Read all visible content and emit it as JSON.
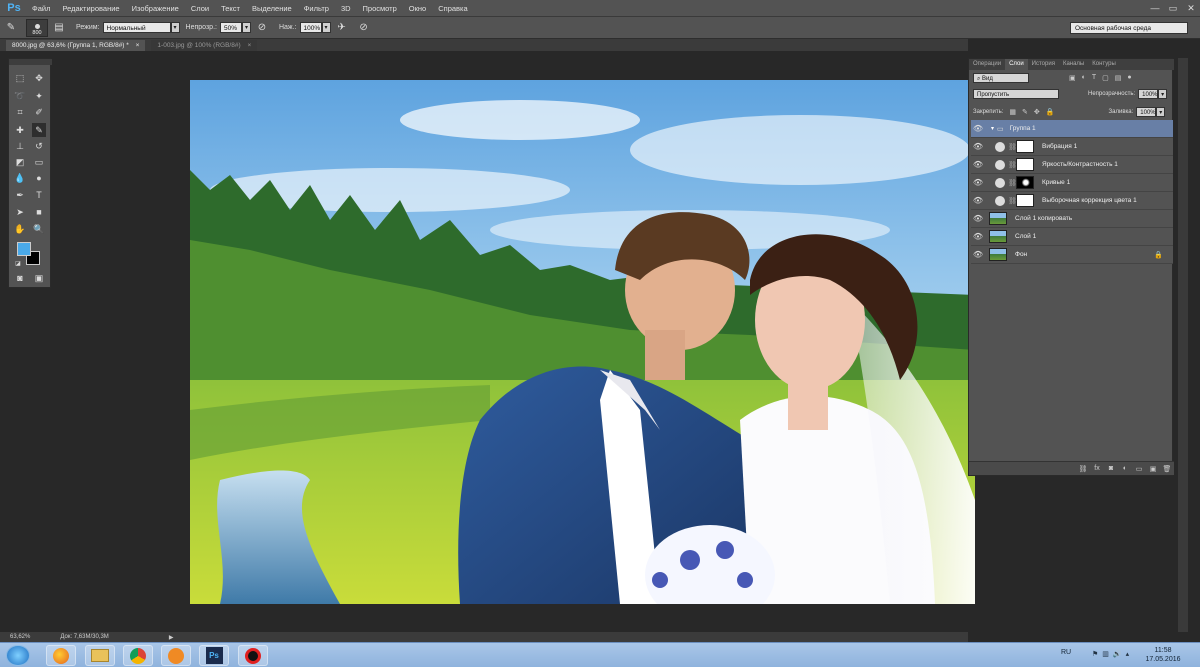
{
  "menu": {
    "logo": "Ps",
    "items": [
      "Файл",
      "Редактирование",
      "Изображение",
      "Слои",
      "Текст",
      "Выделение",
      "Фильтр",
      "3D",
      "Просмотр",
      "Окно",
      "Справка"
    ]
  },
  "window_controls": [
    "—",
    "▭",
    "✕"
  ],
  "options": {
    "brush_size": "800",
    "mode_label": "Режим:",
    "mode_value": "Нормальный",
    "opacity_label": "Непрозр.:",
    "opacity_value": "50%",
    "flow_label": "Наж.:",
    "flow_value": "100%",
    "workspace": "Основная рабочая среда"
  },
  "tabs": [
    {
      "label": "8000.jpg @ 63,6% (Группа 1, RGB/8#) *",
      "close": "×"
    },
    {
      "label": "1-003.jpg @ 100% (RGB/8#)",
      "close": "×"
    }
  ],
  "colors": {
    "foreground": "#4aa9e8",
    "background": "#000000",
    "selected_layer": "#687fa6",
    "ui_panel": "#535353"
  },
  "layers_panel": {
    "tabs": [
      "Операции",
      "Слои",
      "История",
      "Каналы",
      "Контуры"
    ],
    "active_tab": "Слои",
    "filter_kind": "Вид",
    "blend_mode": "Пропустить",
    "opacity_label": "Непрозрачность:",
    "opacity_value": "100%",
    "lock_label": "Закрепить:",
    "fill_label": "Заливка:",
    "fill_value": "100%",
    "layers": [
      {
        "name": "Группа 1",
        "type": "group",
        "selected": true
      },
      {
        "name": "Вибрация 1",
        "type": "adjustment",
        "mask": "white"
      },
      {
        "name": "Яркость/Контрастность 1",
        "type": "adjustment",
        "mask": "white"
      },
      {
        "name": "Кривые 1",
        "type": "adjustment",
        "mask": "black"
      },
      {
        "name": "Выборочная коррекция цвета 1",
        "type": "adjustment",
        "mask": "white"
      },
      {
        "name": "Слой 1 копировать",
        "type": "pixel"
      },
      {
        "name": "Слой 1",
        "type": "pixel"
      },
      {
        "name": "Фон",
        "type": "background",
        "locked": true
      }
    ]
  },
  "status": {
    "zoom": "63,62%",
    "doc": "Док: 7,63М/30,3М"
  },
  "taskbar": {
    "apps": [
      "windows-start",
      "firefox",
      "explorer",
      "chrome",
      "media-player",
      "photoshop",
      "recorder"
    ],
    "photoshop_label": "Ps",
    "lang": "RU",
    "time": "11:58",
    "date": "17.05.2016"
  }
}
